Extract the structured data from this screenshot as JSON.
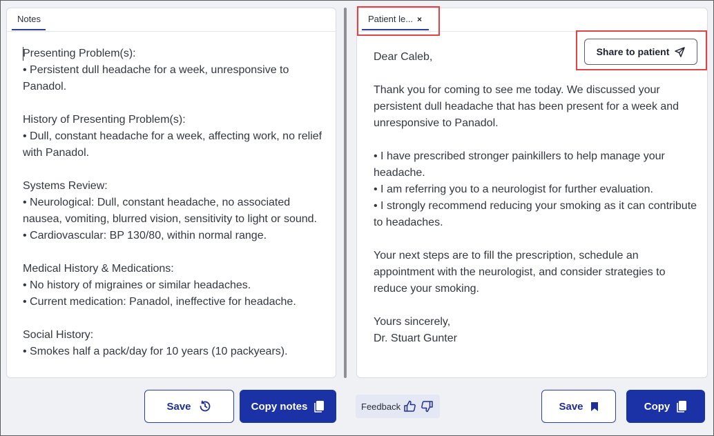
{
  "left_panel": {
    "tab_label": "Notes",
    "text": "Presenting Problem(s):\n• Persistent dull headache for a week, unresponsive to Panadol.\n\nHistory of Presenting Problem(s):\n• Dull, constant headache for a week, affecting work, no relief with Panadol.\n\nSystems Review:\n• Neurological: Dull, constant headache, no associated nausea, vomiting, blurred vision, sensitivity to light or sound.\n• Cardiovascular: BP 130/80, within normal range.\n\nMedical History & Medications:\n• No history of migraines or similar headaches.\n• Current medication: Panadol, ineffective for headache.\n\nSocial History:\n• Smokes half a pack/day for 10 years (10 packyears)."
  },
  "right_panel": {
    "tab_label": "Patient le...",
    "tab_close": "×",
    "share_label": "Share to patient",
    "text": "Dear Caleb,\n\nThank you for coming to see me today. We discussed your persistent dull headache that has been present for a week and unresponsive to Panadol.\n\n• I have prescribed stronger painkillers to help manage your headache.\n• I am referring you to a neurologist for further evaluation.\n• I strongly recommend reducing your smoking as it can contribute to headaches.\n\nYour next steps are to fill the prescription, schedule an appointment with the neurologist, and consider strategies to reduce your smoking.\n\nYours sincerely,\nDr. Stuart Gunter"
  },
  "footer": {
    "notes_save_label": "Save",
    "copy_notes_label": "Copy notes",
    "feedback_label": "Feedback",
    "letter_save_label": "Save",
    "copy_label": "Copy"
  },
  "colors": {
    "primary": "#1b31a6",
    "highlight": "#e04343",
    "feedback_bg": "#e4e8f4"
  }
}
